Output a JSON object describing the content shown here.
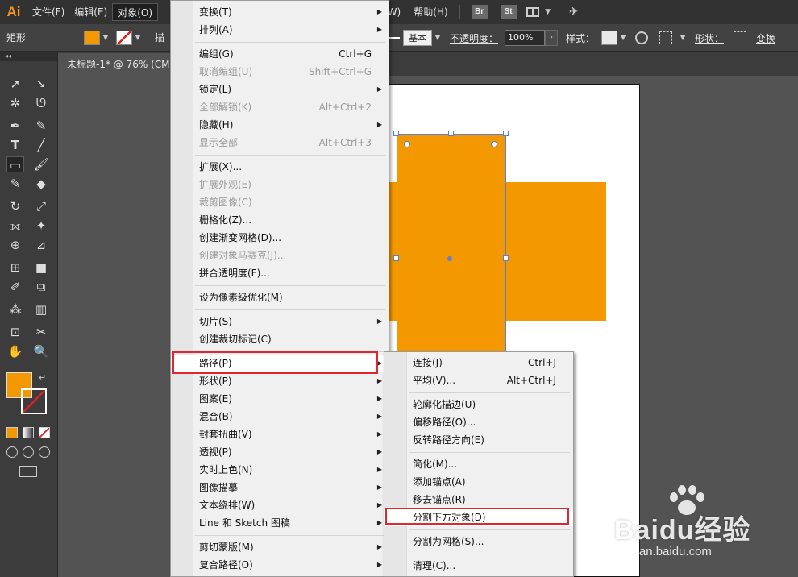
{
  "app": {
    "logo": "Ai"
  },
  "menubar": {
    "items": [
      "文件(F)",
      "编辑(E)",
      "对象(O)"
    ],
    "right_items": [
      "(W)",
      "帮助(H)"
    ],
    "badges": [
      "Br",
      "St"
    ]
  },
  "controlbar": {
    "tool_name": "矩形",
    "fill_color": "#f39800",
    "partial_label": "描",
    "stroke_style": "基本",
    "opacity_label": "不透明度：",
    "opacity_value": "100%",
    "style_label": "样式：",
    "shape_label": "形状：",
    "transform_label": "变换"
  },
  "document": {
    "tab_title": "未标题-1* @ 76% (CM"
  },
  "toolbar": {
    "collapse": "◂◂"
  },
  "colors": {
    "orange": "#f39800",
    "selection_blue": "#5b7fd1",
    "highlight_red": "#e0262e"
  },
  "object_menu": {
    "items": [
      {
        "label": "变换(T)",
        "shortcut": "",
        "submenu": true,
        "disabled": false
      },
      {
        "label": "排列(A)",
        "shortcut": "",
        "submenu": true,
        "disabled": false
      },
      {
        "label": "编组(G)",
        "shortcut": "Ctrl+G",
        "submenu": false,
        "disabled": false
      },
      {
        "label": "取消编组(U)",
        "shortcut": "Shift+Ctrl+G",
        "submenu": false,
        "disabled": true
      },
      {
        "label": "锁定(L)",
        "shortcut": "",
        "submenu": true,
        "disabled": false
      },
      {
        "label": "全部解锁(K)",
        "shortcut": "Alt+Ctrl+2",
        "submenu": false,
        "disabled": true
      },
      {
        "label": "隐藏(H)",
        "shortcut": "",
        "submenu": true,
        "disabled": false
      },
      {
        "label": "显示全部",
        "shortcut": "Alt+Ctrl+3",
        "submenu": false,
        "disabled": true
      },
      {
        "label": "扩展(X)...",
        "shortcut": "",
        "submenu": false,
        "disabled": false
      },
      {
        "label": "扩展外观(E)",
        "shortcut": "",
        "submenu": false,
        "disabled": true
      },
      {
        "label": "裁剪图像(C)",
        "shortcut": "",
        "submenu": false,
        "disabled": true
      },
      {
        "label": "栅格化(Z)...",
        "shortcut": "",
        "submenu": false,
        "disabled": false
      },
      {
        "label": "创建渐变网格(D)...",
        "shortcut": "",
        "submenu": false,
        "disabled": false
      },
      {
        "label": "创建对象马赛克(J)...",
        "shortcut": "",
        "submenu": false,
        "disabled": true
      },
      {
        "label": "拼合透明度(F)...",
        "shortcut": "",
        "submenu": false,
        "disabled": false
      },
      {
        "label": "设为像素级优化(M)",
        "shortcut": "",
        "submenu": false,
        "disabled": false
      },
      {
        "label": "切片(S)",
        "shortcut": "",
        "submenu": true,
        "disabled": false
      },
      {
        "label": "创建裁切标记(C)",
        "shortcut": "",
        "submenu": false,
        "disabled": false
      },
      {
        "label": "路径(P)",
        "shortcut": "",
        "submenu": true,
        "disabled": false
      },
      {
        "label": "形状(P)",
        "shortcut": "",
        "submenu": true,
        "disabled": false
      },
      {
        "label": "图案(E)",
        "shortcut": "",
        "submenu": true,
        "disabled": false
      },
      {
        "label": "混合(B)",
        "shortcut": "",
        "submenu": true,
        "disabled": false
      },
      {
        "label": "封套扭曲(V)",
        "shortcut": "",
        "submenu": true,
        "disabled": false
      },
      {
        "label": "透视(P)",
        "shortcut": "",
        "submenu": true,
        "disabled": false
      },
      {
        "label": "实时上色(N)",
        "shortcut": "",
        "submenu": true,
        "disabled": false
      },
      {
        "label": "图像描摹",
        "shortcut": "",
        "submenu": true,
        "disabled": false
      },
      {
        "label": "文本绕排(W)",
        "shortcut": "",
        "submenu": true,
        "disabled": false
      },
      {
        "label": "Line 和 Sketch 图稿",
        "shortcut": "",
        "submenu": true,
        "disabled": false
      },
      {
        "label": "剪切蒙版(M)",
        "shortcut": "",
        "submenu": true,
        "disabled": false
      },
      {
        "label": "复合路径(O)",
        "shortcut": "",
        "submenu": true,
        "disabled": false
      }
    ]
  },
  "path_submenu": {
    "items": [
      {
        "label": "连接(J)",
        "shortcut": "Ctrl+J"
      },
      {
        "label": "平均(V)...",
        "shortcut": "Alt+Ctrl+J"
      },
      {
        "label": "轮廓化描边(U)",
        "shortcut": ""
      },
      {
        "label": "偏移路径(O)...",
        "shortcut": ""
      },
      {
        "label": "反转路径方向(E)",
        "shortcut": ""
      },
      {
        "label": "简化(M)...",
        "shortcut": ""
      },
      {
        "label": "添加锚点(A)",
        "shortcut": ""
      },
      {
        "label": "移去锚点(R)",
        "shortcut": ""
      },
      {
        "label": "分割下方对象(D)",
        "shortcut": ""
      },
      {
        "label": "分割为网格(S)...",
        "shortcut": ""
      },
      {
        "label": "清理(C)...",
        "shortcut": ""
      }
    ]
  },
  "watermark": {
    "brand": "Baidu经验",
    "url": "jingyan.baidu.com"
  }
}
